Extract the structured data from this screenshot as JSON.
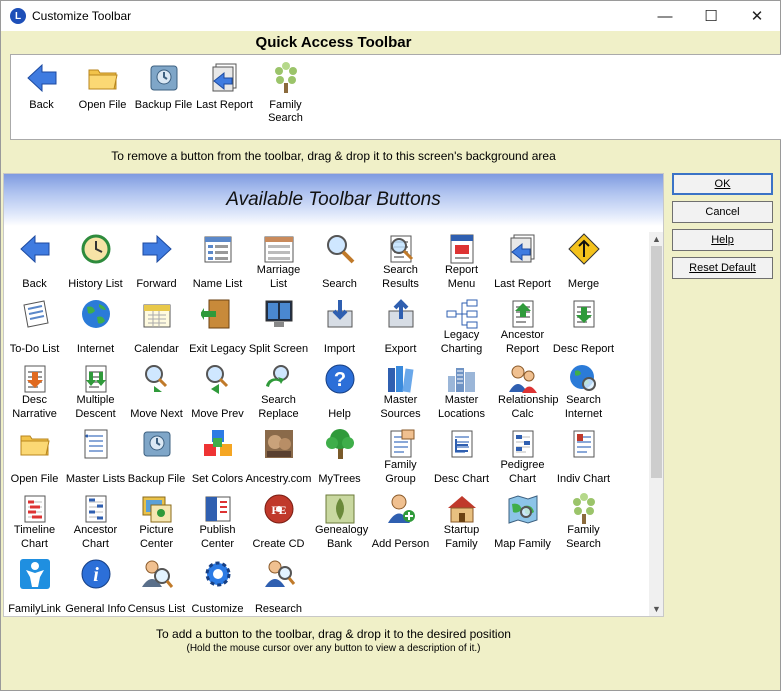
{
  "window": {
    "title": "Customize Toolbar",
    "app_icon_letter": "L",
    "controls": {
      "minimize": "—",
      "maximize": "☐",
      "close": "✕"
    }
  },
  "quick_access": {
    "title": "Quick Access Toolbar",
    "items": [
      {
        "label": "Back",
        "icon": "back-arrow-icon"
      },
      {
        "label": "Open File",
        "icon": "folder-icon"
      },
      {
        "label": "Backup File",
        "icon": "backup-drive-icon"
      },
      {
        "label": "Last Report",
        "icon": "last-report-icon"
      },
      {
        "label": "Family Search",
        "icon": "family-tree-icon"
      }
    ]
  },
  "hints": {
    "remove": "To remove a button from the toolbar, drag & drop it to this screen's background area",
    "add": "To add a button to the toolbar, drag & drop it to the desired position",
    "description": "(Hold the mouse cursor over any button to view a description of it.)"
  },
  "available": {
    "title": "Available Toolbar Buttons",
    "items": [
      {
        "label": "Back",
        "icon": "back-arrow-icon"
      },
      {
        "label": "History List",
        "icon": "history-clock-icon"
      },
      {
        "label": "Forward",
        "icon": "forward-arrow-icon"
      },
      {
        "label": "Name List",
        "icon": "name-list-icon"
      },
      {
        "label": "Marriage List",
        "icon": "marriage-list-icon"
      },
      {
        "label": "Search",
        "icon": "magnifier-icon"
      },
      {
        "label": "Search Results",
        "icon": "search-results-icon"
      },
      {
        "label": "Report Menu",
        "icon": "report-menu-icon"
      },
      {
        "label": "Last Report",
        "icon": "last-report-icon"
      },
      {
        "label": "Merge",
        "icon": "merge-sign-icon"
      },
      {
        "label": "To-Do List",
        "icon": "todo-list-icon"
      },
      {
        "label": "Internet",
        "icon": "globe-icon"
      },
      {
        "label": "Calendar",
        "icon": "calendar-icon"
      },
      {
        "label": "Exit Legacy",
        "icon": "exit-door-icon"
      },
      {
        "label": "Split Screen",
        "icon": "split-screen-icon"
      },
      {
        "label": "Import",
        "icon": "import-icon"
      },
      {
        "label": "Export",
        "icon": "export-icon"
      },
      {
        "label": "Legacy Charting",
        "icon": "charting-icon"
      },
      {
        "label": "Ancestor Report",
        "icon": "ancestor-report-icon"
      },
      {
        "label": "Desc Report",
        "icon": "desc-report-icon"
      },
      {
        "label": "Desc Narrative",
        "icon": "desc-narrative-icon"
      },
      {
        "label": "Multiple Descent",
        "icon": "multiple-descent-icon"
      },
      {
        "label": "Move Next",
        "icon": "move-next-icon"
      },
      {
        "label": "Move Prev",
        "icon": "move-prev-icon"
      },
      {
        "label": "Search Replace",
        "icon": "search-replace-icon"
      },
      {
        "label": "Help",
        "icon": "help-icon"
      },
      {
        "label": "Master Sources",
        "icon": "books-icon"
      },
      {
        "label": "Master Locations",
        "icon": "city-icon"
      },
      {
        "label": "Relationship Calc",
        "icon": "relationship-icon"
      },
      {
        "label": "Search Internet",
        "icon": "search-internet-icon"
      },
      {
        "label": "Open File",
        "icon": "folder-icon"
      },
      {
        "label": "Master Lists",
        "icon": "master-lists-icon"
      },
      {
        "label": "Backup File",
        "icon": "backup-drive-icon"
      },
      {
        "label": "Set Colors",
        "icon": "color-cubes-icon"
      },
      {
        "label": "Ancestry.com",
        "icon": "ancestry-icon"
      },
      {
        "label": "MyTrees",
        "icon": "tree-icon"
      },
      {
        "label": "Family Group",
        "icon": "family-group-icon"
      },
      {
        "label": "Desc Chart",
        "icon": "desc-chart-icon"
      },
      {
        "label": "Pedigree Chart",
        "icon": "pedigree-chart-icon"
      },
      {
        "label": "Indiv Chart",
        "icon": "indiv-chart-icon"
      },
      {
        "label": "Timeline Chart",
        "icon": "timeline-chart-icon"
      },
      {
        "label": "Ancestor Chart",
        "icon": "ancestor-chart-icon"
      },
      {
        "label": "Picture Center",
        "icon": "picture-center-icon"
      },
      {
        "label": "Publish Center",
        "icon": "publish-center-icon"
      },
      {
        "label": "Create CD",
        "icon": "create-cd-icon"
      },
      {
        "label": "Genealogy Bank",
        "icon": "genealogy-bank-icon"
      },
      {
        "label": "Add Person",
        "icon": "add-person-icon"
      },
      {
        "label": "Startup Family",
        "icon": "startup-family-icon"
      },
      {
        "label": "Map Family",
        "icon": "map-family-icon"
      },
      {
        "label": "Family Search",
        "icon": "family-tree-icon"
      },
      {
        "label": "FamilyLink",
        "icon": "familylink-icon"
      },
      {
        "label": "General Info",
        "icon": "info-icon"
      },
      {
        "label": "Census List",
        "icon": "census-icon"
      },
      {
        "label": "Customize",
        "icon": "gear-icon"
      },
      {
        "label": "Research",
        "icon": "research-icon"
      }
    ]
  },
  "buttons": {
    "ok": "OK",
    "cancel": "Cancel",
    "help": "Help",
    "reset": "Reset Default"
  }
}
